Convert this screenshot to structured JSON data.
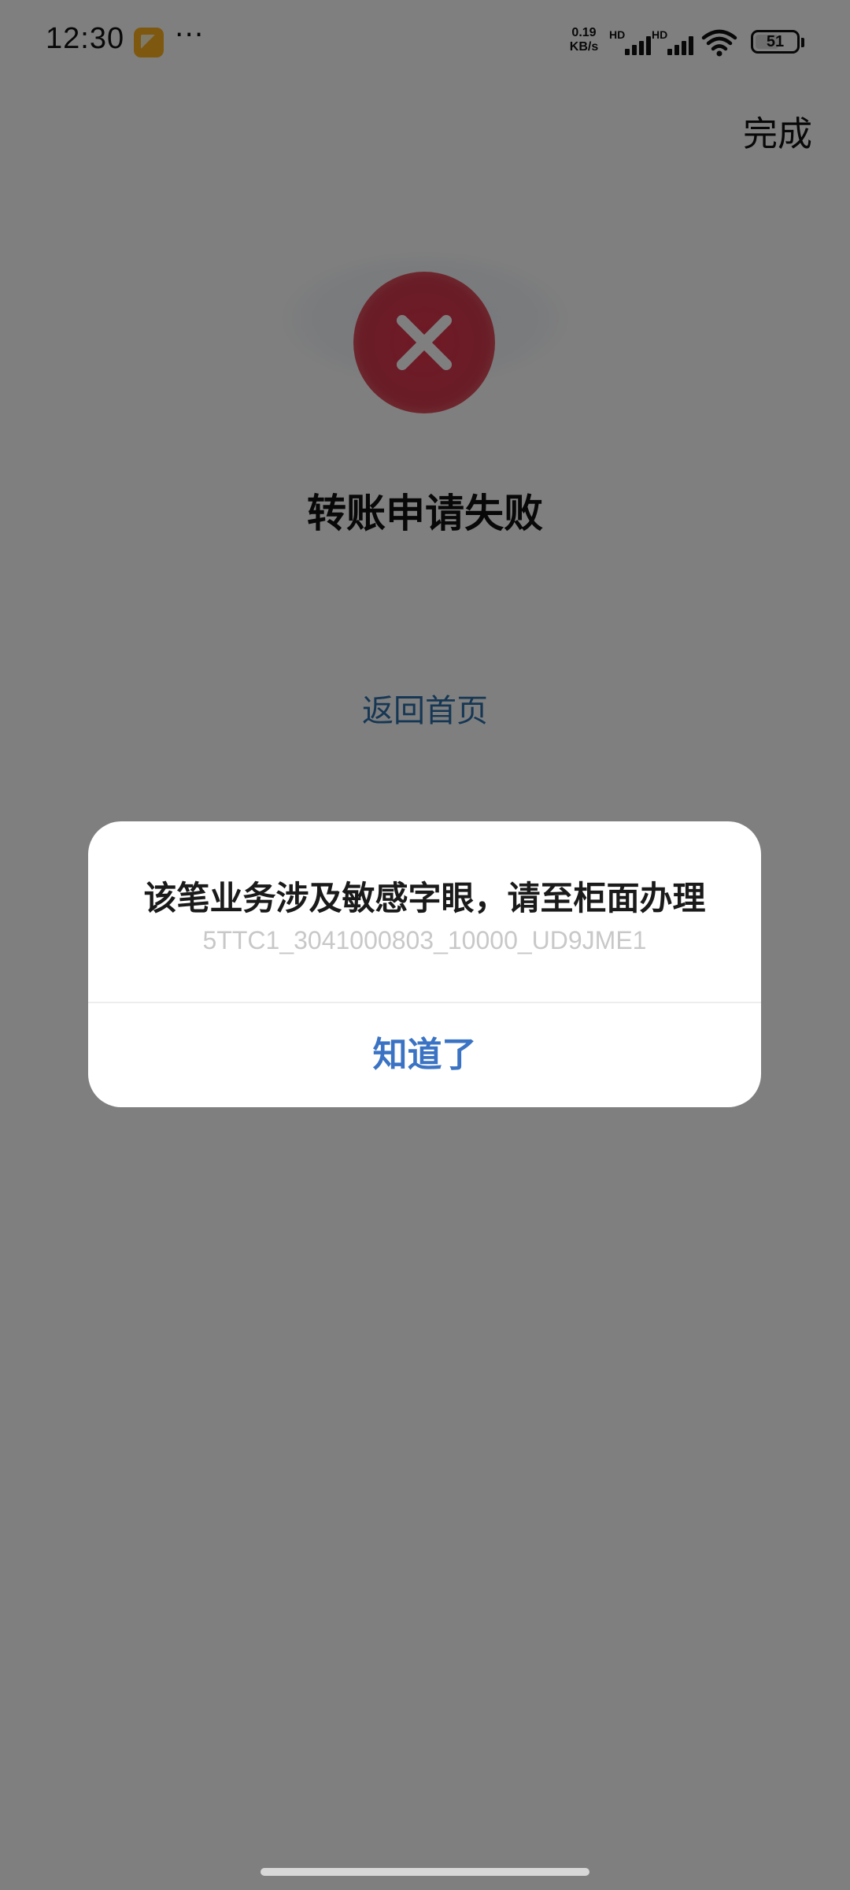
{
  "status_bar": {
    "time": "12:30",
    "more_indicator": "···",
    "net_speed_value": "0.19",
    "net_speed_unit": "KB/s",
    "sim1_label": "HD",
    "sim2_label": "HD",
    "battery_level": "51",
    "icons": [
      "gallery-app-icon",
      "signal-icon",
      "signal-icon",
      "wifi-icon",
      "battery-icon"
    ]
  },
  "header": {
    "done_label": "完成"
  },
  "result": {
    "status_icon": "error-x-icon",
    "title": "转账申请失败",
    "home_link_label": "返回首页"
  },
  "dialog": {
    "message": "该笔业务涉及敏感字眼，请至柜面办理",
    "code": "5TTC1_3041000803_10000_UD9JME1",
    "confirm_label": "知道了"
  },
  "colors": {
    "error_red": "#d33a4d",
    "link_blue": "#2d6fa8",
    "dialog_button_blue": "#3b73c4",
    "overlay": "rgba(0,0,0,0.5)"
  }
}
